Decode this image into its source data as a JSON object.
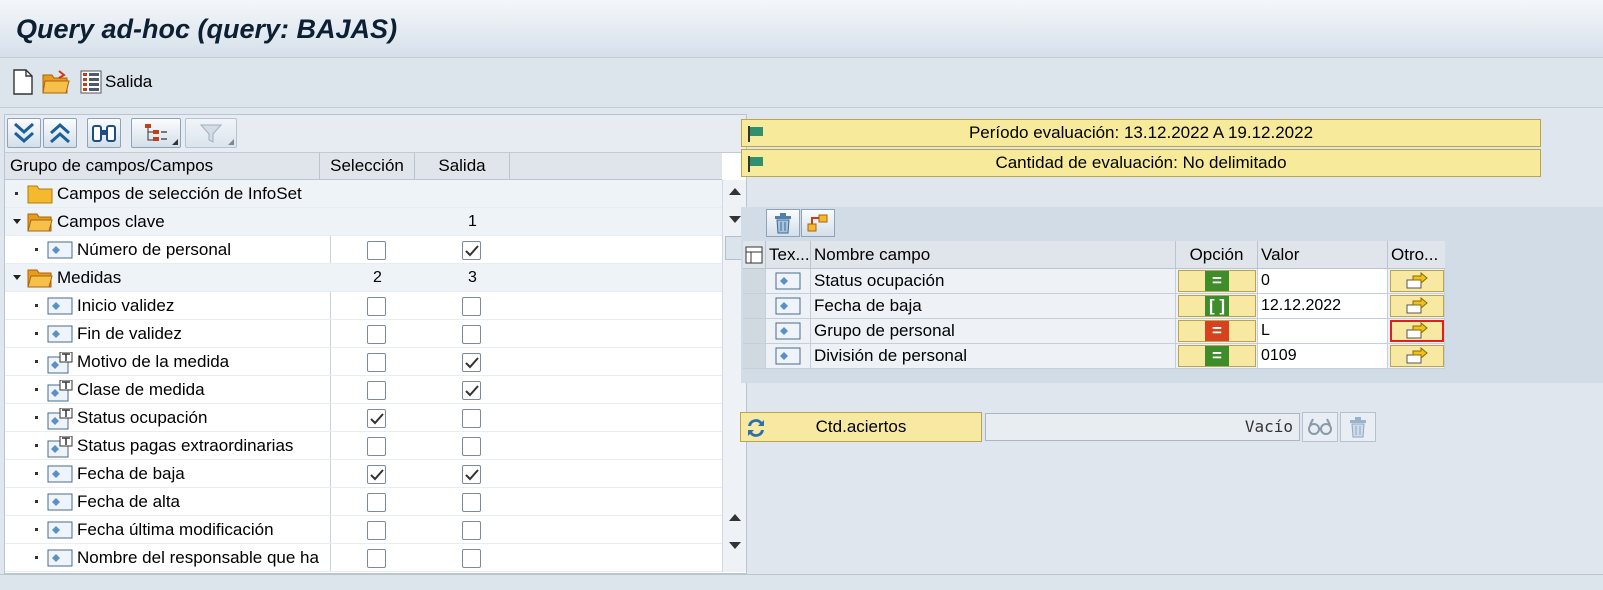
{
  "window": {
    "title": "Query ad-hoc (query: BAJAS)"
  },
  "toolbar": {
    "output_label": "Salida"
  },
  "tree": {
    "headers": {
      "group": "Grupo de campos/Campos",
      "selection": "Selección",
      "output": "Salida"
    },
    "rows": [
      {
        "label": "Campos de selección de InfoSet",
        "sel": "",
        "out": ""
      },
      {
        "label": "Campos clave",
        "sel": "",
        "out": "1"
      },
      {
        "label": "Número de personal",
        "sel_checked": false,
        "out_checked": true
      },
      {
        "label": "Medidas",
        "sel": "2",
        "out": "3"
      },
      {
        "label": "Inicio validez",
        "sel_checked": false,
        "out_checked": false
      },
      {
        "label": "Fin de validez",
        "sel_checked": false,
        "out_checked": false
      },
      {
        "label": "Motivo de la medida",
        "sel_checked": false,
        "out_checked": true
      },
      {
        "label": "Clase de medida",
        "sel_checked": false,
        "out_checked": true
      },
      {
        "label": "Status ocupación",
        "sel_checked": true,
        "out_checked": false
      },
      {
        "label": "Status pagas extraordinarias",
        "sel_checked": false,
        "out_checked": false
      },
      {
        "label": "Fecha de baja",
        "sel_checked": true,
        "out_checked": true
      },
      {
        "label": "Fecha de alta",
        "sel_checked": false,
        "out_checked": false
      },
      {
        "label": "Fecha última modificación",
        "sel_checked": false,
        "out_checked": false
      },
      {
        "label": "Nombre del responsable que ha",
        "sel_checked": false,
        "out_checked": false
      }
    ]
  },
  "period_bar": "Período evaluación: 13.12.2022 A 19.12.2022",
  "quantity_bar": "Cantidad de evaluación: No delimitado",
  "selection_grid": {
    "headers": {
      "text": "Tex...",
      "field": "Nombre campo",
      "option": "Opción",
      "value": "Valor",
      "other": "Otro..."
    },
    "rows": [
      {
        "field": "Status ocupación",
        "option": "equal",
        "option_color": "#3f8c2b",
        "value": "0"
      },
      {
        "field": "Fecha de baja",
        "option": "between",
        "option_color": "#3f8c2b",
        "value": "12.12.2022"
      },
      {
        "field": "Grupo de personal",
        "option": "not-equal",
        "option_color": "#d8401e",
        "value": "L"
      },
      {
        "field": "División de personal",
        "option": "equal",
        "option_color": "#3f8c2b",
        "value": "0109"
      }
    ]
  },
  "hits": {
    "button_label": "Ctd.aciertos",
    "value": "Vacío"
  }
}
